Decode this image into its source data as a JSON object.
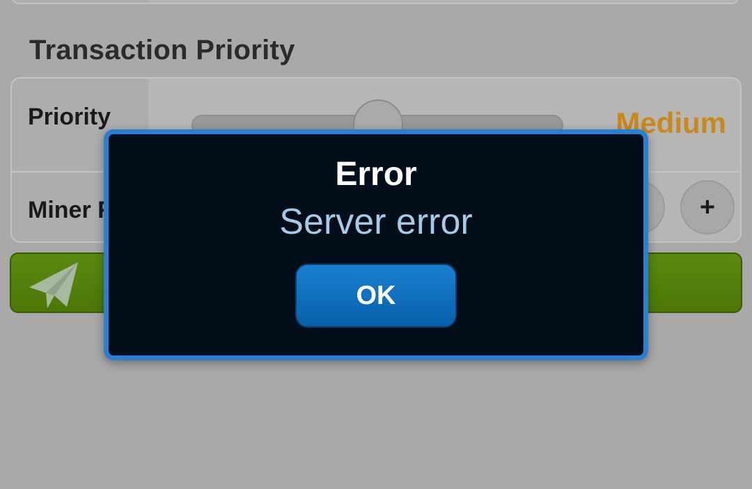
{
  "section": {
    "title": "Transaction Priority"
  },
  "priority": {
    "label": "Priority",
    "value": "Medium",
    "value_color": "#c9881a",
    "slider_level": 0.5
  },
  "miner_fee": {
    "label": "Miner F",
    "increase_label": "+"
  },
  "send": {
    "icon": "paper-plane-icon",
    "color": "#5a8a10"
  },
  "dialog": {
    "title": "Error",
    "message": "Server error",
    "ok_label": "OK",
    "border_color": "#2a7fce",
    "background": "#020f1a"
  }
}
